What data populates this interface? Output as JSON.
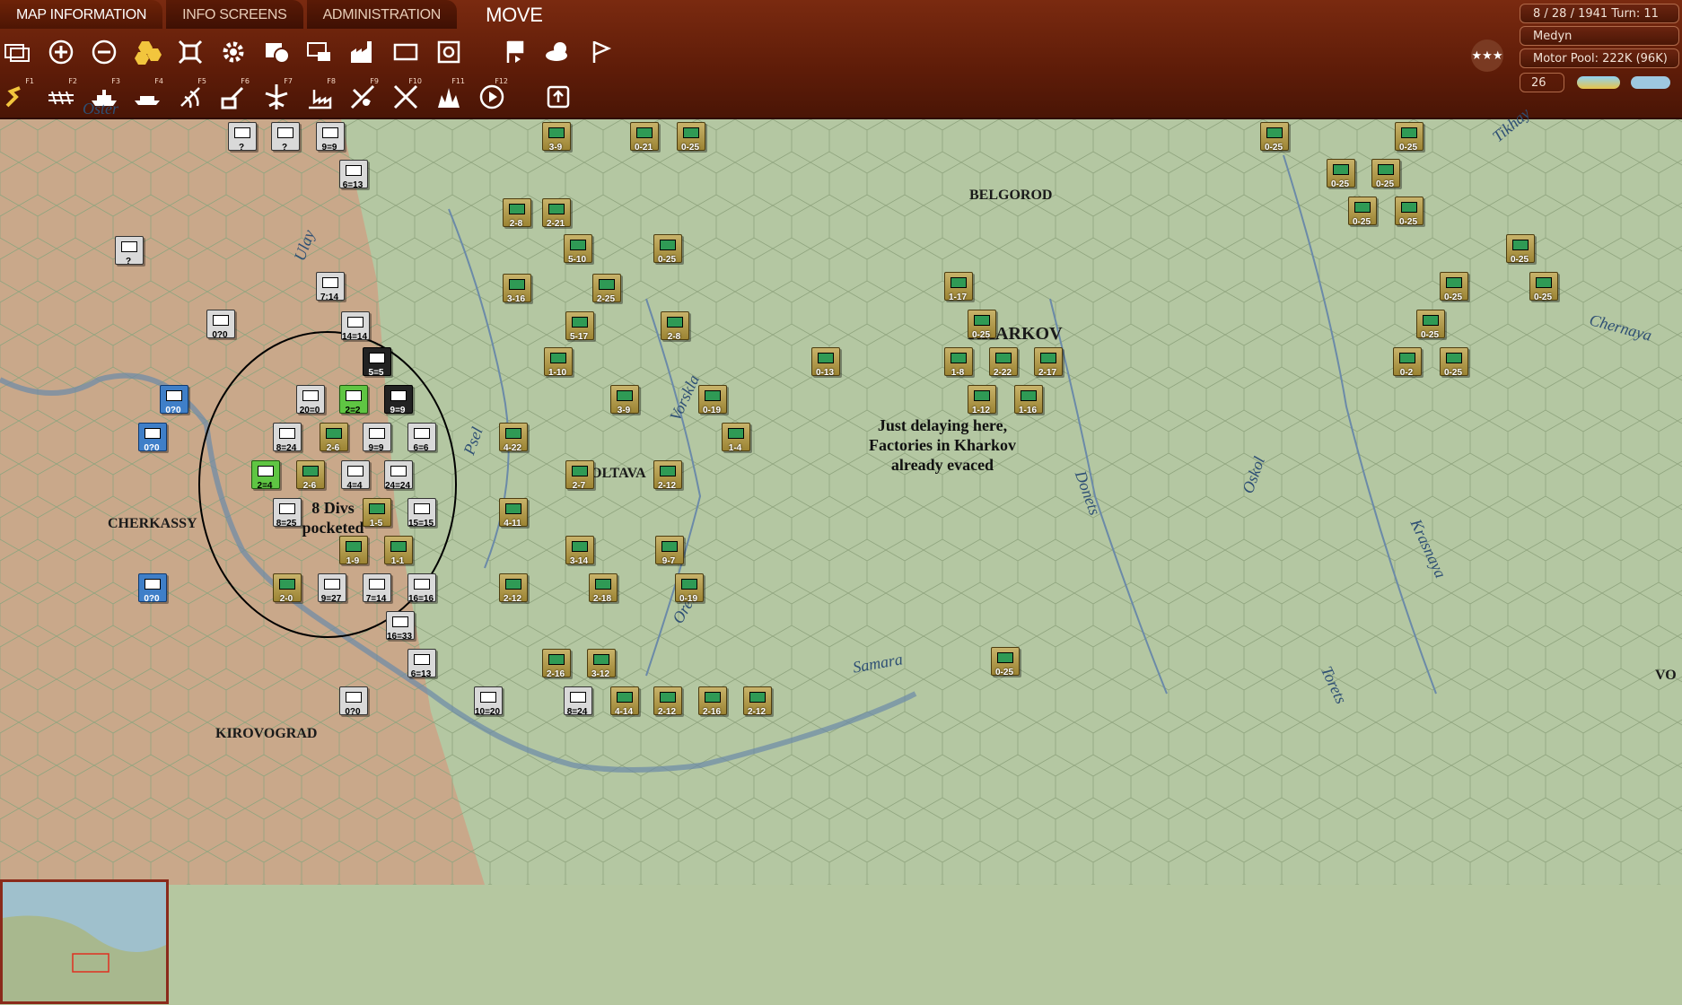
{
  "tabs": {
    "map_information": "MAP INFORMATION",
    "info_screens": "INFO SCREENS",
    "administration": "ADMINISTRATION",
    "mode": "MOVE"
  },
  "fkeys": [
    "F1",
    "F2",
    "F3",
    "F4",
    "F5",
    "F6",
    "F7",
    "F8",
    "F9",
    "F10",
    "F11",
    "F12"
  ],
  "info": {
    "date_turn": "8 / 28 / 1941  Turn: 11",
    "hq_name": "Medyn",
    "motor_pool": "Motor Pool:  222K (96K)",
    "value": "26",
    "rating": "★★★"
  },
  "map": {
    "cities": [
      "BELGOROD",
      "KHARKOV",
      "CHERKASSY",
      "KIROVOGRAD",
      "OLTAVA",
      "VO"
    ],
    "rivers": [
      "Oster",
      "Ulay",
      "Psel",
      "Vorskla",
      "Orel",
      "Donets",
      "Oskol",
      "Samara",
      "Tikhay",
      "Chernaya",
      "Krasnaya",
      "Torets"
    ],
    "notes": {
      "kharkov": [
        "Just delaying here,",
        "Factories in Kharkov",
        "already evaced"
      ],
      "pocket": [
        "8 Divs",
        "pocketed"
      ]
    }
  },
  "units": {
    "german": [
      "3-9",
      "0-21",
      "0-25",
      "2-8",
      "2-21",
      "5-10",
      "0-25",
      "3-16",
      "2-25",
      "5-17",
      "2-8",
      "1-10",
      "3-9",
      "0-19",
      "0-13",
      "1-17",
      "0-25",
      "1-8",
      "2-22",
      "2-17",
      "1-12",
      "1-16",
      "4-22",
      "1-4",
      "2-7",
      "2-12",
      "4-11",
      "3-14",
      "9-7",
      "2-12",
      "2-18",
      "0-19",
      "2-16",
      "3-12",
      "4-14",
      "2-12",
      "2-16",
      "2-12",
      "0-25",
      "0-25",
      "0-25",
      "0-25",
      "0-25",
      "0-25",
      "0-25",
      "0-25",
      "0-25",
      "0-25",
      "0-2",
      "0-25",
      "0-25",
      "2-6",
      "2-6",
      "1-5",
      "1-9",
      "1-1",
      "2-0"
    ],
    "soviet": [
      "9=9",
      "6=13",
      "?",
      "?",
      "?",
      "7:14",
      "14=14",
      "5=5",
      "0?0",
      "20=0",
      "2=2",
      "9=9",
      "0?0",
      "0?0",
      "8=24",
      "9=9",
      "6=6",
      "2=4",
      "4=4",
      "24=24",
      "8=25",
      "15=15",
      "9=27",
      "7=14",
      "16=16",
      "16=33",
      "6=13",
      "0?0",
      "0?0",
      "10=20",
      "8=24"
    ]
  }
}
